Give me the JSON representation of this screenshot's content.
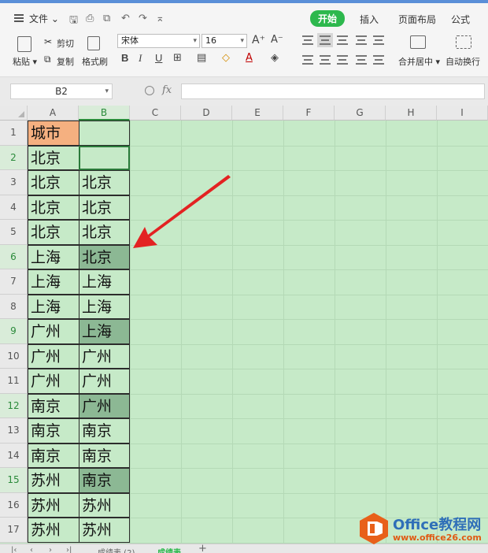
{
  "menubar": {
    "file_label": "文件",
    "tabs": [
      "开始",
      "插入",
      "页面布局",
      "公式"
    ]
  },
  "ribbon": {
    "paste_label": "粘贴",
    "cut_label": "剪切",
    "copy_label": "复制",
    "format_painter_label": "格式刷",
    "font_name": "宋体",
    "font_size": "16",
    "bold": "B",
    "italic": "I",
    "underline": "U",
    "merge_center_label": "合并居中",
    "wrap_text_label": "自动换行"
  },
  "formula_bar": {
    "name_box": "B2",
    "fx_label": "fx",
    "formula": ""
  },
  "grid": {
    "columns": [
      "A",
      "B",
      "C",
      "D",
      "E",
      "F",
      "G",
      "H",
      "I"
    ],
    "rows": [
      "1",
      "2",
      "3",
      "4",
      "5",
      "6",
      "7",
      "8",
      "9",
      "10",
      "11",
      "12",
      "13",
      "14",
      "15",
      "16",
      "17"
    ],
    "col_a": [
      "城市",
      "北京",
      "北京",
      "北京",
      "北京",
      "上海",
      "上海",
      "上海",
      "广州",
      "广州",
      "广州",
      "南京",
      "南京",
      "南京",
      "苏州",
      "苏州",
      "苏州"
    ],
    "col_b": [
      "",
      "",
      "北京",
      "北京",
      "北京",
      "北京",
      "上海",
      "上海",
      "上海",
      "广州",
      "广州",
      "广州",
      "南京",
      "南京",
      "南京",
      "苏州",
      "苏州"
    ],
    "selected_cell": "B2"
  },
  "sheets": [
    "成绩表 (2)",
    "成绩表"
  ],
  "watermark": {
    "title": "Office教程网",
    "url": "www.office26.com"
  },
  "colors": {
    "grid_fill": "#c6eac8",
    "header_cell": "#f5b080",
    "highlight_cell": "#8cb894",
    "accent": "#2db84d"
  }
}
